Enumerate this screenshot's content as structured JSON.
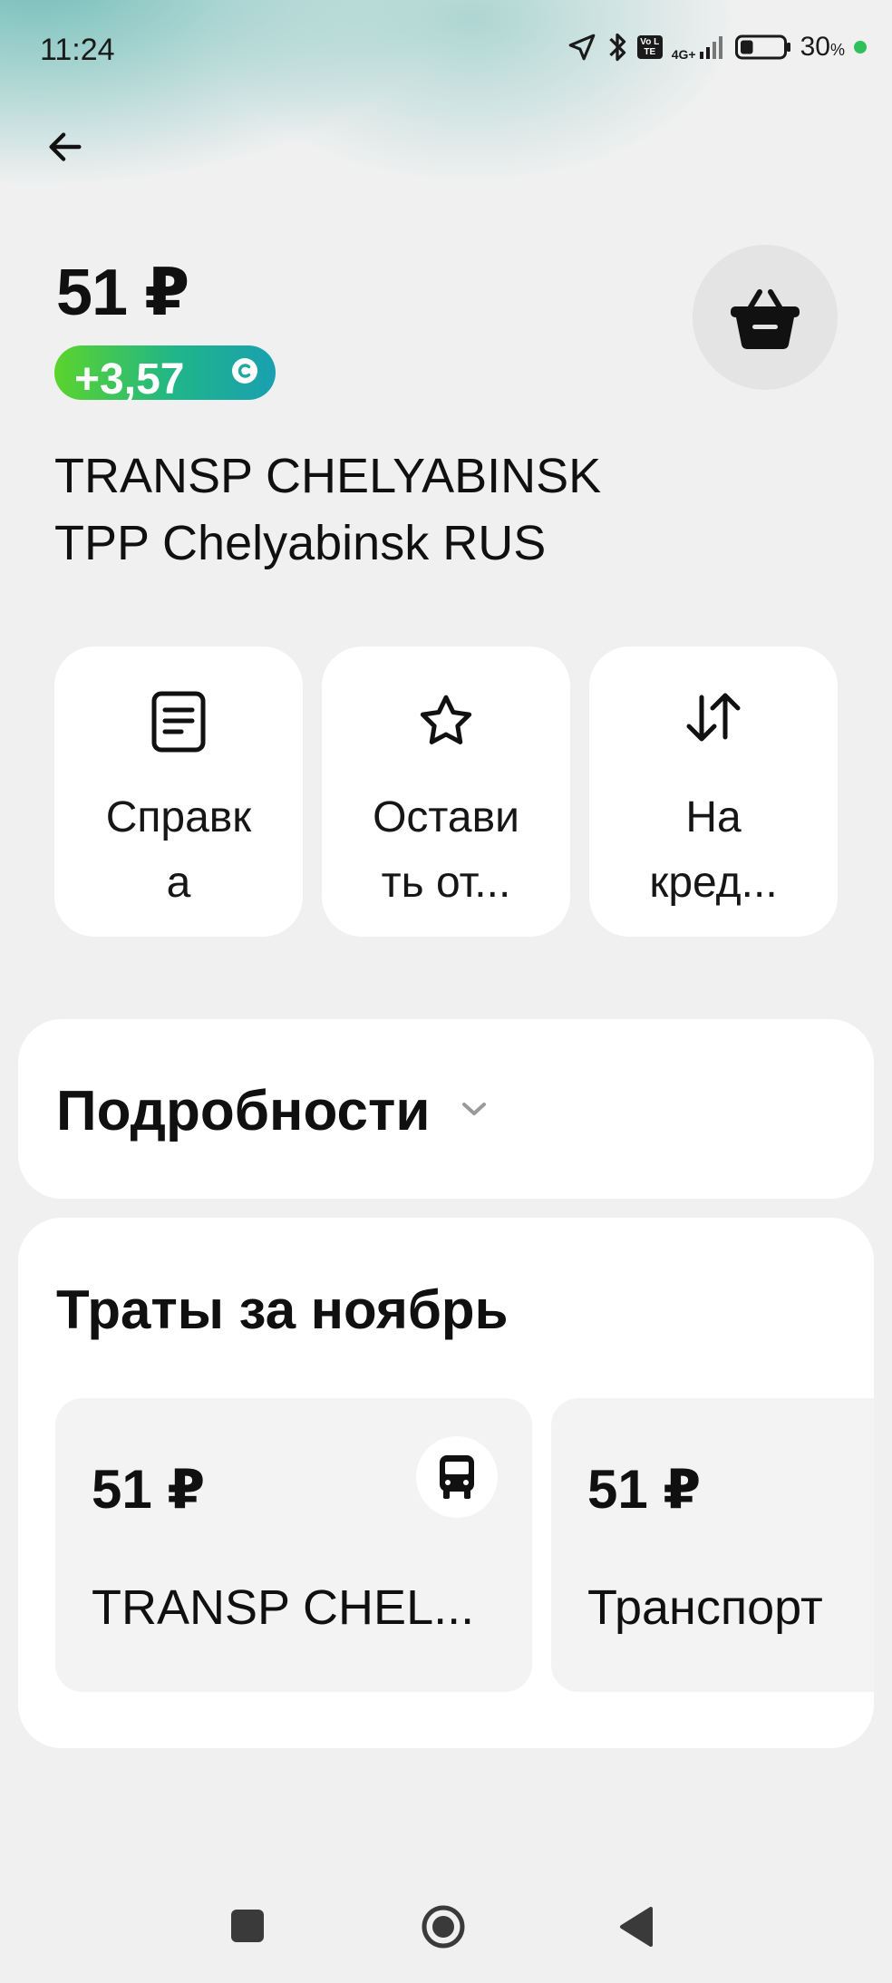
{
  "status_bar": {
    "time": "11:24",
    "volte": "Vo LTE",
    "network": "4G+",
    "battery_percent": "30",
    "battery_unit": "%",
    "battery_level": 0.3
  },
  "header": {
    "back_icon": "arrow-left-icon",
    "amount": "51 ₽",
    "cashback": "+3,57",
    "basket_icon": "basket-icon"
  },
  "merchant": {
    "line1": "TRANSP CHELYABINSK",
    "line2": "TPP Chelyabinsk RUS"
  },
  "actions": [
    {
      "label": "Справк\nа",
      "icon": "document-icon"
    },
    {
      "label": "Остави\nть от...",
      "icon": "star-icon"
    },
    {
      "label": "На\nкред...",
      "icon": "arrows-swap-icon"
    }
  ],
  "details": {
    "title": "Подробности"
  },
  "spending": {
    "title": "Траты за ноябрь",
    "tiles": [
      {
        "amount": "51 ₽",
        "text": "TRANSP CHEL...",
        "icon": "bus-icon"
      },
      {
        "amount": "51 ₽",
        "text": "Транспорт"
      }
    ]
  },
  "colors": {
    "background": "#f0f0f0",
    "card": "#ffffff",
    "cashback_gradient_start": "#5bd42c",
    "cashback_gradient_end": "#1aa0b0",
    "status_dot": "#2fc05a"
  }
}
